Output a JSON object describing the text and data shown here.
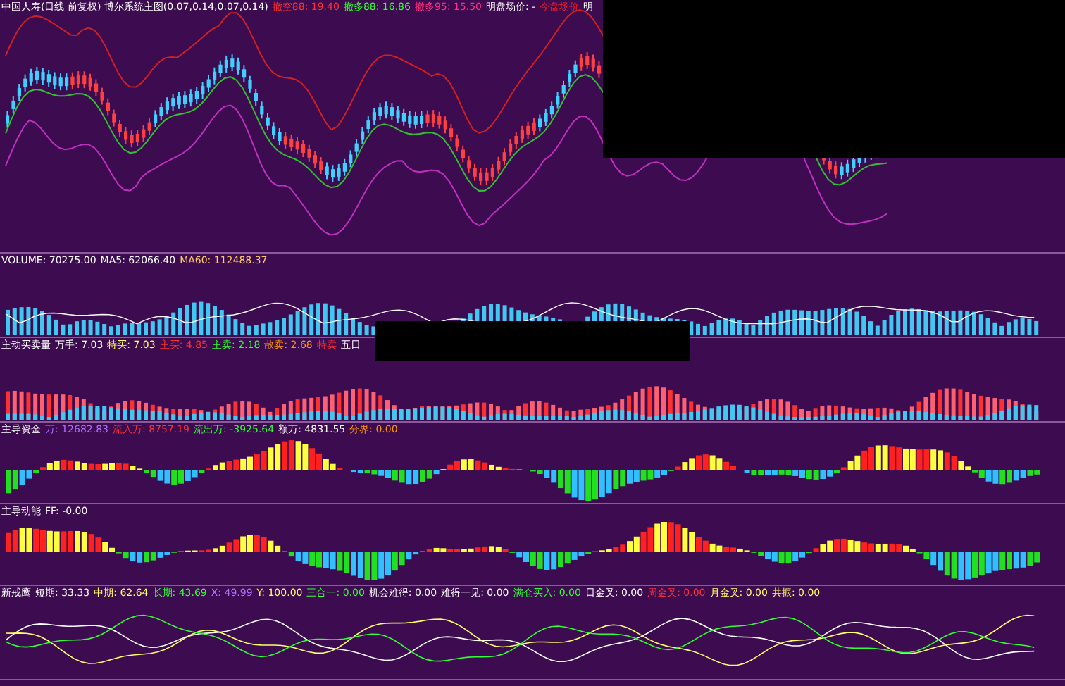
{
  "panels": [
    {
      "kind": "candles",
      "labels": [
        {
          "text": "中国人寿(日线 前复权) 博尔系统主图(0.07,0.14,0.07,0.14)",
          "color": "#ffffff"
        },
        {
          "text": "撤空88: 19.40",
          "color": "#ff3030"
        },
        {
          "text": "撤多88: 16.86",
          "color": "#30ff30"
        },
        {
          "text": "撤多95: 15.50",
          "color": "#ff3080"
        },
        {
          "text": "明盘场价: -",
          "color": "#ffffff"
        },
        {
          "text": "今盘场价",
          "color": "#ff2020"
        },
        {
          "text": "明",
          "color": "#ffffff"
        }
      ]
    },
    {
      "kind": "volume",
      "labels": [
        {
          "text": "VOLUME: 70275.00",
          "color": "#ffffff"
        },
        {
          "text": "MA5: 62066.40",
          "color": "#ffffff"
        },
        {
          "text": "MA60: 112488.37",
          "color": "#ffcc66"
        }
      ]
    },
    {
      "kind": "bars",
      "labels": [
        {
          "text": "主动买卖量",
          "color": "#ffffff"
        },
        {
          "text": "万手: 7.03",
          "color": "#ffffff"
        },
        {
          "text": "特买: 7.03",
          "color": "#ffff66"
        },
        {
          "text": "主买: 4.85",
          "color": "#ff3030"
        },
        {
          "text": "主卖: 2.18",
          "color": "#30ff30"
        },
        {
          "text": "散卖: 2.68",
          "color": "#ff9900"
        },
        {
          "text": "特卖",
          "color": "#ff3030"
        },
        {
          "text": "五日",
          "color": "#ffffff"
        }
      ]
    },
    {
      "kind": "histogram",
      "labels": [
        {
          "text": "主导资金",
          "color": "#ffffff"
        },
        {
          "text": "万: 12682.83",
          "color": "#b070ff"
        },
        {
          "text": "流入万: 8757.19",
          "color": "#ff3030"
        },
        {
          "text": "流出万: -3925.64",
          "color": "#30ff30"
        },
        {
          "text": "额万: 4831.55",
          "color": "#ffffff"
        },
        {
          "text": "分界: 0.00",
          "color": "#ff9900"
        }
      ]
    },
    {
      "kind": "histogram",
      "labels": [
        {
          "text": "主导动能",
          "color": "#ffffff"
        },
        {
          "text": "FF: -0.00",
          "color": "#ffffff"
        }
      ]
    },
    {
      "kind": "lines",
      "labels": [
        {
          "text": "新戒鹰",
          "color": "#ffffff"
        },
        {
          "text": "短期: 33.33",
          "color": "#ffffff"
        },
        {
          "text": "中期: 62.64",
          "color": "#ffff66"
        },
        {
          "text": "长期: 43.69",
          "color": "#30ff30"
        },
        {
          "text": "X: 49.99",
          "color": "#b070ff"
        },
        {
          "text": "Y: 100.00",
          "color": "#ffff66"
        },
        {
          "text": "三合一: 0.00",
          "color": "#30ff30"
        },
        {
          "text": "机会难得: 0.00",
          "color": "#ffffff"
        },
        {
          "text": "难得一见: 0.00",
          "color": "#ffffff"
        },
        {
          "text": "满仓买入: 0.00",
          "color": "#30ff30"
        },
        {
          "text": "日金叉: 0.00",
          "color": "#ffffff"
        },
        {
          "text": "周金叉: 0.00",
          "color": "#ff3030"
        },
        {
          "text": "月金叉: 0.00",
          "color": "#ffff66"
        },
        {
          "text": "共振: 0.00",
          "color": "#ffff66"
        }
      ]
    }
  ]
}
